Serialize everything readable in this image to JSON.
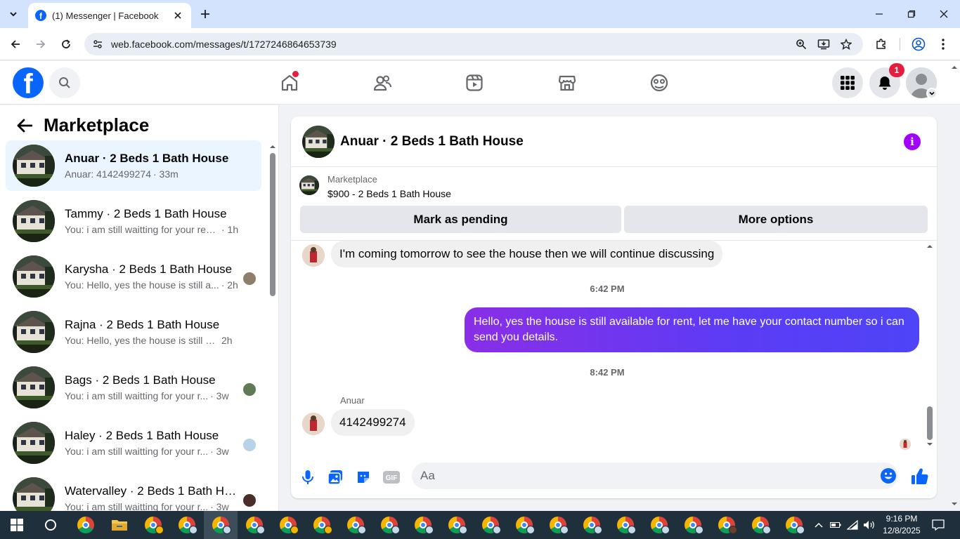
{
  "browser": {
    "tab_title": "(1) Messenger | Facebook",
    "url": "web.facebook.com/messages/t/1727246864653739"
  },
  "header": {
    "notification_count": "1",
    "logo_letter": "f"
  },
  "sidebar": {
    "title": "Marketplace",
    "conversations": [
      {
        "name": "Anuar · 2 Beds 1 Bath House",
        "preview": "Anuar: 4142499274",
        "time": "· 33m",
        "active": true
      },
      {
        "name": "Tammy · 2 Beds 1 Bath House",
        "preview": "You: i am still waitting for your resp...",
        "time": "· 1h"
      },
      {
        "name": "Karysha · 2 Beds 1 Bath House",
        "preview": "You: Hello, yes the house is still a...",
        "time": "· 2h"
      },
      {
        "name": "Rajna · 2 Beds 1 Bath House",
        "preview": "You: Hello, yes the house is still avai...",
        "time": " 2h"
      },
      {
        "name": "Bags · 2 Beds 1 Bath House",
        "preview": "You: i am still waitting for your r...",
        "time": "· 3w"
      },
      {
        "name": "Haley · 2 Beds 1 Bath House",
        "preview": "You: i am still waitting for your r...",
        "time": "· 3w"
      },
      {
        "name": "Watervalley · 2 Beds 1 Bath Ho...",
        "preview": "You: i am still waitting for your r...",
        "time": "· 3w"
      }
    ]
  },
  "chat": {
    "title": "Anuar · 2 Beds 1 Bath House",
    "marketplace_label": "Marketplace",
    "listing": "$900 - 2 Beds 1 Bath House",
    "mark_pending_label": "Mark as pending",
    "more_options_label": "More options",
    "messages": {
      "m1": "I'm coming tomorrow to see the house then we will continue discussing",
      "t1": "6:42 PM",
      "m2": "Hello, yes the house is still available for rent, let me have your contact number so i can send you  details.",
      "t2": "8:42 PM",
      "sender": "Anuar",
      "m3": "4142499274"
    },
    "composer_placeholder": "Aa",
    "gif_label": "GIF"
  },
  "taskbar": {
    "time": "9:16 PM",
    "date": "12/8/2025"
  },
  "colors": {
    "fb_blue": "#0866ff",
    "messenger_purple": "#a100ff",
    "notification_red": "#e41e3f"
  }
}
